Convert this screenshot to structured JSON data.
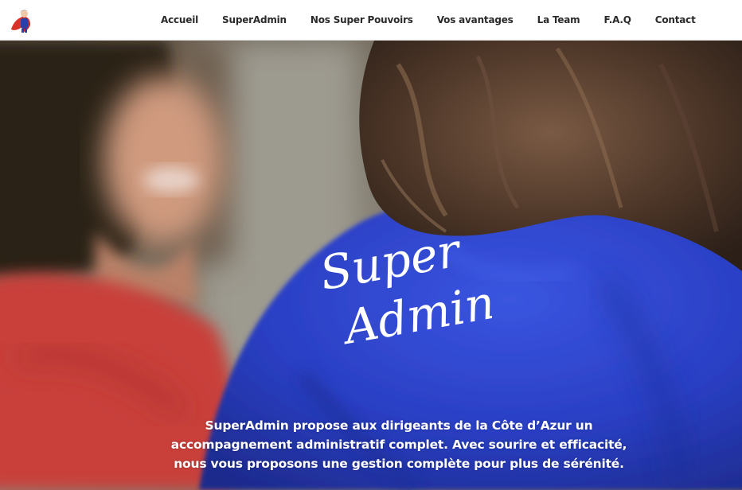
{
  "nav": {
    "items": [
      {
        "label": "Accueil"
      },
      {
        "label": "SuperAdmin"
      },
      {
        "label": "Nos Super Pouvoirs"
      },
      {
        "label": "Vos avantages"
      },
      {
        "label": "La Team"
      },
      {
        "label": "F.A.Q"
      },
      {
        "label": "Contact"
      }
    ]
  },
  "hero": {
    "logo_line1": "Super",
    "logo_line2": "Admin",
    "lines": [
      "SuperAdmin propose aux dirigeants de la Côte d’Azur un",
      "accompagnement administratif complet. Avec sourire et efficacité,",
      "nous vous proposons une gestion complète pour plus de sérénité."
    ]
  },
  "colors": {
    "nav_text": "#2a2a2a",
    "shirt_blue": "#2a3fc4",
    "shirt_red": "#c9403a",
    "hero_text": "#ffffff"
  },
  "icons": {
    "site_logo": "superhero-icon"
  }
}
